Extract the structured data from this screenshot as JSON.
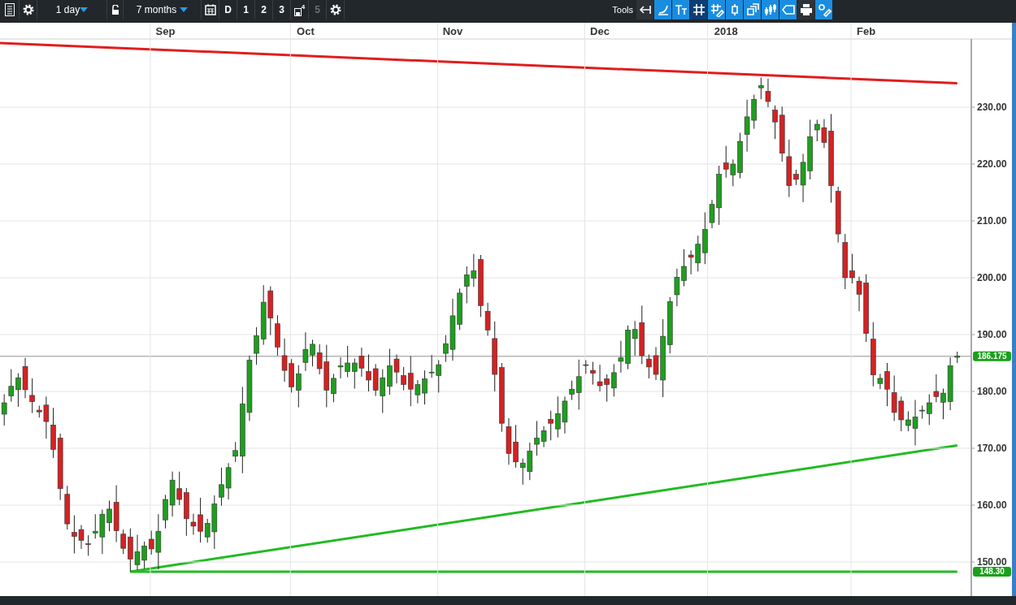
{
  "toolbar": {
    "interval": "1 day",
    "range": "7 months",
    "periods": [
      {
        "label": "D",
        "disabled": false
      },
      {
        "label": "1",
        "disabled": false
      },
      {
        "label": "2",
        "disabled": false
      },
      {
        "label": "3",
        "disabled": false
      },
      {
        "label": "4",
        "disabled": false
      },
      {
        "label": "5",
        "disabled": true
      }
    ],
    "tools_label": "Tools",
    "tools": [
      {
        "highlighted": false
      },
      {
        "highlighted": true
      },
      {
        "highlighted": true
      },
      {
        "highlighted": false
      },
      {
        "highlighted": true
      },
      {
        "highlighted": true
      },
      {
        "highlighted": true
      },
      {
        "highlighted": true
      },
      {
        "highlighted": true
      },
      {
        "highlighted": false
      },
      {
        "highlighted": true
      }
    ]
  },
  "chart": {
    "badges": [
      "186.175",
      "148.30"
    ],
    "chart_data": {
      "type": "candlestick",
      "ylim": [
        144,
        242
      ],
      "grid": true,
      "categories": [
        null,
        null,
        null,
        null,
        null,
        null,
        null,
        null,
        null,
        null,
        null,
        null,
        null,
        null,
        null,
        null,
        null,
        null,
        null,
        null,
        null,
        null,
        null,
        "Sep",
        null,
        null,
        null,
        null,
        null,
        null,
        null,
        null,
        null,
        null,
        null,
        null,
        null,
        null,
        null,
        null,
        null,
        null,
        null,
        "Oct",
        null,
        null,
        null,
        null,
        null,
        null,
        null,
        null,
        null,
        null,
        null,
        null,
        null,
        null,
        null,
        null,
        null,
        null,
        null,
        null,
        "Nov",
        null,
        null,
        null,
        null,
        null,
        null,
        null,
        null,
        null,
        null,
        null,
        null,
        null,
        null,
        null,
        null,
        null,
        null,
        null,
        null,
        "Dec",
        null,
        null,
        null,
        null,
        null,
        null,
        null,
        null,
        null,
        null,
        null,
        null,
        null,
        null,
        null,
        null,
        null,
        "2018",
        null,
        null,
        null,
        null,
        null,
        null,
        null,
        null,
        null,
        null,
        null,
        null,
        null,
        null,
        null,
        null,
        null,
        null,
        null,
        "Feb",
        null,
        null,
        null,
        null,
        null,
        null,
        null,
        null,
        null,
        null,
        null,
        null,
        null
      ],
      "ohlc": [
        [
          176,
          179.5,
          174,
          178
        ],
        [
          179.2,
          183.9,
          178.2,
          180.9
        ],
        [
          180.3,
          183.2,
          177.3,
          182.4
        ],
        [
          184.4,
          185.9,
          178.8,
          180.3
        ],
        [
          179.3,
          182.3,
          176.2,
          178.2
        ],
        [
          176.7,
          177.5,
          175.4,
          176.4
        ],
        [
          177.6,
          179.1,
          171.7,
          174.7
        ],
        [
          174.1,
          177.1,
          168.3,
          169.8
        ],
        [
          171.8,
          172.6,
          160.9,
          162.9
        ],
        [
          161.9,
          163.4,
          155.7,
          156.7
        ],
        [
          155.2,
          158.2,
          151.5,
          154.5
        ],
        [
          155.7,
          156.5,
          152.3,
          153.8
        ],
        [
          153.2,
          154.7,
          151.1,
          153.1
        ],
        [
          155.1,
          158.4,
          154.1,
          155.4
        ],
        [
          154.4,
          159.2,
          151.4,
          158.4
        ],
        [
          156.9,
          160.8,
          155.4,
          159.3
        ],
        [
          160.5,
          163.5,
          153.5,
          155.5
        ],
        [
          154.9,
          155.7,
          151.4,
          152.4
        ],
        [
          154.4,
          155.9,
          148.3,
          150.5
        ],
        [
          149.5,
          154.8,
          148.6,
          151.8
        ],
        [
          150.3,
          153.6,
          148.8,
          152.8
        ],
        [
          154,
          155.5,
          151.3,
          152.3
        ],
        [
          151.7,
          158.4,
          148.7,
          155.4
        ],
        [
          157.4,
          161.8,
          155.9,
          161
        ],
        [
          160,
          165.9,
          158,
          164.4
        ],
        [
          162.9,
          165.9,
          160,
          161
        ],
        [
          162.2,
          163,
          154.6,
          157.6
        ],
        [
          157,
          158.5,
          154.8,
          156.3
        ],
        [
          158.3,
          161.3,
          153.4,
          155.4
        ],
        [
          154.4,
          157.6,
          153.4,
          156.8
        ],
        [
          155.3,
          161.7,
          152.3,
          160.2
        ],
        [
          161.4,
          166.6,
          159.9,
          163.6
        ],
        [
          163,
          167.4,
          161,
          166.6
        ],
        [
          168.6,
          171.1,
          167.6,
          169.6
        ],
        [
          168.6,
          180.8,
          165.6,
          177.8
        ],
        [
          176.3,
          186.3,
          174.8,
          185.5
        ],
        [
          186.7,
          191.3,
          184.7,
          189.8
        ],
        [
          189.2,
          198.7,
          188.2,
          195.7
        ],
        [
          197.7,
          198.5,
          189.9,
          192.9
        ],
        [
          191.9,
          193.4,
          186.3,
          187.8
        ],
        [
          186.3,
          189.3,
          181.7,
          183.7
        ],
        [
          184.9,
          185.7,
          179.8,
          180.8
        ],
        [
          180.2,
          184.6,
          177.2,
          183.1
        ],
        [
          185.1,
          190.4,
          183.6,
          187.4
        ],
        [
          186.4,
          189.1,
          184.4,
          188.3
        ],
        [
          186.8,
          188.3,
          183,
          184
        ],
        [
          185.2,
          188.2,
          177.2,
          180.2
        ],
        [
          179.6,
          183.1,
          178.1,
          182.3
        ],
        [
          184.3,
          186,
          182.3,
          184.5
        ],
        [
          183.5,
          188,
          182.5,
          185
        ],
        [
          183.5,
          185.8,
          180.5,
          185
        ],
        [
          186.2,
          187.7,
          182.6,
          184.1
        ],
        [
          183.5,
          186.5,
          180,
          182
        ],
        [
          184,
          184.8,
          179.2,
          180.2
        ],
        [
          179.2,
          183.9,
          176.2,
          182.4
        ],
        [
          180.9,
          187.5,
          179.4,
          184.5
        ],
        [
          185.7,
          186.5,
          181.4,
          183.4
        ],
        [
          182.8,
          184.3,
          180.2,
          181.2
        ],
        [
          183.2,
          186.2,
          177.4,
          180.4
        ],
        [
          179.4,
          182,
          177.9,
          181.2
        ],
        [
          179.7,
          183.7,
          177.7,
          182.2
        ],
        [
          183.4,
          186.4,
          182.4,
          183.4
        ],
        [
          182.8,
          185.5,
          179.8,
          184.7
        ],
        [
          186.7,
          189.9,
          185.2,
          188.4
        ],
        [
          187.4,
          196.3,
          185.4,
          193.3
        ],
        [
          191.8,
          198.1,
          190.8,
          197.3
        ],
        [
          198.5,
          202,
          195.5,
          200.5
        ],
        [
          199.9,
          204.2,
          198.4,
          201.2
        ],
        [
          203.2,
          204,
          193.1,
          195.1
        ],
        [
          194.1,
          195.6,
          189.8,
          190.8
        ],
        [
          189.3,
          192.3,
          180,
          183
        ],
        [
          184.2,
          185,
          172.9,
          174.4
        ],
        [
          173.8,
          175.3,
          167.1,
          169.1
        ],
        [
          171.1,
          174.1,
          166.6,
          167.6
        ],
        [
          166.6,
          168.2,
          163.6,
          167.4
        ],
        [
          165.9,
          171,
          164.4,
          169.5
        ],
        [
          170.7,
          174.8,
          168.7,
          171.8
        ],
        [
          171.2,
          173.9,
          170.2,
          173.1
        ],
        [
          175.1,
          176.6,
          171.4,
          174.4
        ],
        [
          173.4,
          179.1,
          171.9,
          176.1
        ],
        [
          174.6,
          179.1,
          172.6,
          178.3
        ],
        [
          179.5,
          181.9,
          178.5,
          180.4
        ],
        [
          179.8,
          185.6,
          176.8,
          182.6
        ],
        [
          184.6,
          185.5,
          183.1,
          184.7
        ],
        [
          183.7,
          185.2,
          181.2,
          183.2
        ],
        [
          181.7,
          184.7,
          180,
          181
        ],
        [
          182.2,
          183,
          178.2,
          181.2
        ],
        [
          180.6,
          184.8,
          179.1,
          183.3
        ],
        [
          185.3,
          188.9,
          183.3,
          185.9
        ],
        [
          184.9,
          191.6,
          183.9,
          190.8
        ],
        [
          189.3,
          192.4,
          186.3,
          190.9
        ],
        [
          192.1,
          195.1,
          184.8,
          186.3
        ],
        [
          185.7,
          186.5,
          182.3,
          184.3
        ],
        [
          186.3,
          187.8,
          182,
          183
        ],
        [
          182,
          192.7,
          179,
          189.7
        ],
        [
          188.2,
          196.6,
          186.7,
          195.8
        ],
        [
          197,
          201.6,
          195,
          200.1
        ],
        [
          199.5,
          205,
          198.5,
          202
        ],
        [
          204,
          204.8,
          200.6,
          203.6
        ],
        [
          202.6,
          207.4,
          201.1,
          205.9
        ],
        [
          204.4,
          211.5,
          202.4,
          208.5
        ],
        [
          209.7,
          213.7,
          208.7,
          212.9
        ],
        [
          212.3,
          219.7,
          209.3,
          218.2
        ],
        [
          220.2,
          223.2,
          217.6,
          219.1
        ],
        [
          218.1,
          220.8,
          216.1,
          220
        ],
        [
          218.5,
          225.5,
          217.5,
          224
        ],
        [
          225.2,
          231.3,
          222.2,
          228.3
        ],
        [
          227.7,
          232.2,
          226.2,
          231.4
        ],
        [
          233.4,
          235.2,
          231.4,
          233.8
        ],
        [
          232.8,
          235,
          230,
          231
        ],
        [
          229.5,
          230.3,
          224.4,
          227.4
        ],
        [
          228.6,
          230.1,
          220.4,
          221.9
        ],
        [
          221.3,
          224.3,
          214.2,
          216.2
        ],
        [
          218.2,
          219,
          216.3,
          217.3
        ],
        [
          216.3,
          221.8,
          213.3,
          220.3
        ],
        [
          218.8,
          227.8,
          217.3,
          224.8
        ],
        [
          226,
          227.8,
          224,
          227
        ],
        [
          226.4,
          227.9,
          222.8,
          223.8
        ],
        [
          225.8,
          228.8,
          213.2,
          216.2
        ],
        [
          215.2,
          216,
          206.2,
          207.7
        ],
        [
          206.2,
          207.7,
          198,
          200
        ],
        [
          201.2,
          204.2,
          199,
          200
        ],
        [
          199.4,
          200.2,
          194.1,
          197.1
        ],
        [
          199.1,
          200.6,
          188.7,
          190.2
        ],
        [
          189.2,
          192.2,
          180.9,
          182.9
        ],
        [
          181.4,
          183.1,
          180.4,
          182.3
        ],
        [
          183.5,
          185,
          177.4,
          180.4
        ],
        [
          179.8,
          182.8,
          174.8,
          176.3
        ],
        [
          178.3,
          179.1,
          173,
          175
        ],
        [
          174,
          176.5,
          173,
          175
        ],
        [
          173.5,
          178.5,
          170.5,
          175.5
        ],
        [
          176.7,
          177.5,
          175.2,
          176.7
        ],
        [
          176.1,
          179.5,
          174.1,
          178
        ],
        [
          180,
          183,
          178.1,
          179.1
        ],
        [
          178.1,
          180.5,
          175.1,
          179.7
        ],
        [
          178.2,
          186,
          176.7,
          184.5
        ],
        [
          186,
          187,
          185,
          186.2
        ]
      ],
      "yticks": [
        {
          "value": 150,
          "label": "150.00"
        },
        {
          "value": 160,
          "label": "160.00"
        },
        {
          "value": 170,
          "label": "170.00"
        },
        {
          "value": 180,
          "label": "180.00"
        },
        {
          "value": 190,
          "label": "190.00"
        },
        {
          "value": 200,
          "label": "200.00"
        },
        {
          "value": 210,
          "label": "210.00"
        },
        {
          "value": 220,
          "label": "220.00"
        },
        {
          "value": 230,
          "label": "230.00"
        }
      ]
    }
  }
}
